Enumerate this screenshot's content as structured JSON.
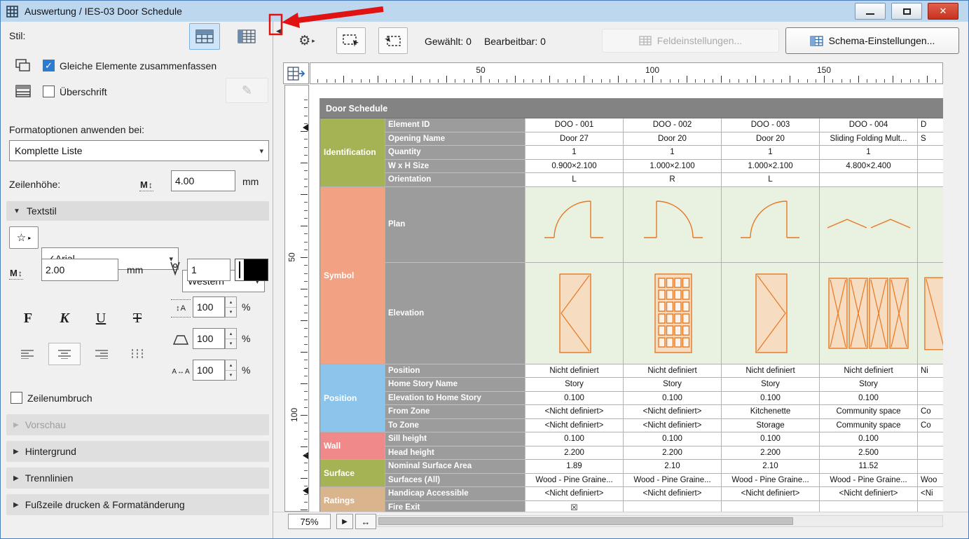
{
  "window": {
    "title": "Auswertung / IES-03 Door Schedule",
    "controls": {
      "close": "✕"
    }
  },
  "icons": {
    "check": "✓",
    "collapse": "◀",
    "play": "▶",
    "fit": "↔",
    "chevron": "▾",
    "expanded": "▼",
    "collapsed": "▶",
    "up": "▴",
    "down": "▾",
    "gear": "⚙",
    "star": "☆",
    "menu_arrow": "▸",
    "pencil": "✎",
    "letter_m": "M",
    "updown": "↕",
    "letter_a": "A"
  },
  "sidebar": {
    "style_label": "Stil:",
    "merge_checkbox_label": "Gleiche Elemente zusammenfassen",
    "heading_checkbox_label": "Überschrift",
    "format_section_label": "Formatoptionen anwenden bei:",
    "format_scope_value": "Komplette Liste",
    "row_height_label": "Zeilenhöhe:",
    "row_height_value": "4.00",
    "row_height_unit": "mm",
    "textstyle": {
      "header": "Textstil",
      "font_value": "✓Arial",
      "script_value": "Western",
      "size_value": "2.00",
      "size_unit": "mm",
      "pen_value": "1",
      "bold": "F",
      "italic": "K",
      "underline": "U",
      "strike": "T",
      "line_spacing_value": "100",
      "width_factor_value": "100",
      "letter_spacing_value": "100",
      "percent": "%"
    },
    "wrap_checkbox_label": "Zeilenumbruch",
    "sections": [
      {
        "label": "Vorschau",
        "disabled": true
      },
      {
        "label": "Hintergrund",
        "disabled": false
      },
      {
        "label": "Trennlinien",
        "disabled": false
      },
      {
        "label": "Fußzeile drucken & Formatänderung",
        "disabled": false
      }
    ]
  },
  "toolbar": {
    "selected_label": "Gewählt:",
    "selected_count": "0",
    "editable_label": "Bearbeitbar:",
    "editable_count": "0",
    "field_settings_label": "Feldeinstellungen...",
    "schema_settings_label": "Schema-Einstellungen..."
  },
  "rulers": {
    "horizontal_labels": [
      "50",
      "100",
      "150"
    ],
    "vertical_labels": [
      "50",
      "100"
    ]
  },
  "statusbar": {
    "zoom": "75%"
  },
  "colors": {
    "titlebar": "#bdd7ee",
    "window_border": "#4a7ebb",
    "accent": "#2b7cd3",
    "close_button": "#c8321e",
    "annotation": "#e11212",
    "header_bg": "#838383",
    "label_bg": "#9c9c9c",
    "symbol_stroke": "#e87722",
    "symbol_fill": "#f6dcc1",
    "symbol_cell_bg": "#e9f1e1"
  },
  "schedule": {
    "title": "Door Schedule",
    "groups": [
      {
        "name": "Identification",
        "color": "#a6b354",
        "rows": [
          {
            "label": "Element ID",
            "values": [
              "DOO - 001",
              "DOO - 002",
              "DOO - 003",
              "DOO - 004",
              "D"
            ]
          },
          {
            "label": "Opening Name",
            "values": [
              "Door 27",
              "Door 20",
              "Door 20",
              "Sliding Folding Mult...",
              "S"
            ]
          },
          {
            "label": "Quantity",
            "values": [
              "1",
              "1",
              "1",
              "1",
              ""
            ]
          },
          {
            "label": "W x H Size",
            "values": [
              "0.900×2.100",
              "1.000×2.100",
              "1.000×2.100",
              "4.800×2.400",
              ""
            ]
          },
          {
            "label": "Orientation",
            "values": [
              "L",
              "R",
              "L",
              "",
              ""
            ]
          }
        ]
      },
      {
        "name": "Symbol",
        "color": "#f2a183",
        "rows": [
          {
            "label": "Plan",
            "symbol": "plan"
          },
          {
            "label": "Elevation",
            "symbol": "elevation"
          }
        ]
      },
      {
        "name": "Position",
        "color": "#8cc5ec",
        "rows": [
          {
            "label": "Position",
            "values": [
              "Nicht definiert",
              "Nicht definiert",
              "Nicht definiert",
              "Nicht definiert",
              "Ni"
            ]
          },
          {
            "label": "Home Story Name",
            "values": [
              "Story",
              "Story",
              "Story",
              "Story",
              ""
            ]
          },
          {
            "label": "Elevation to Home Story",
            "values": [
              "0.100",
              "0.100",
              "0.100",
              "0.100",
              ""
            ]
          },
          {
            "label": "From Zone",
            "values": [
              "<Nicht definiert>",
              "<Nicht definiert>",
              "Kitchenette",
              "Community space",
              "Co"
            ]
          },
          {
            "label": "To Zone",
            "values": [
              "<Nicht definiert>",
              "<Nicht definiert>",
              "Storage",
              "Community space",
              "Co"
            ]
          }
        ]
      },
      {
        "name": "Wall",
        "color": "#f08a8a",
        "rows": [
          {
            "label": "Sill height",
            "values": [
              "0.100",
              "0.100",
              "0.100",
              "0.100",
              ""
            ]
          },
          {
            "label": "Head height",
            "values": [
              "2.200",
              "2.200",
              "2.200",
              "2.500",
              ""
            ]
          }
        ]
      },
      {
        "name": "Surface",
        "color": "#a6b354",
        "rows": [
          {
            "label": "Nominal Surface Area",
            "values": [
              "1.89",
              "2.10",
              "2.10",
              "11.52",
              ""
            ]
          },
          {
            "label": "Surfaces (All)",
            "values": [
              "Wood - Pine Graine...",
              "Wood - Pine Graine...",
              "Wood - Pine Graine...",
              "Wood - Pine Graine...",
              "Woo"
            ]
          }
        ]
      },
      {
        "name": "Ratings",
        "color": "#d9b48c",
        "rows": [
          {
            "label": "Handicap Accessible",
            "values": [
              "<Nicht definiert>",
              "<Nicht definiert>",
              "<Nicht definiert>",
              "<Nicht definiert>",
              "<Ni"
            ]
          },
          {
            "label": "Fire Exit",
            "values": [
              "☒",
              "",
              "",
              "",
              ""
            ]
          }
        ]
      }
    ]
  }
}
